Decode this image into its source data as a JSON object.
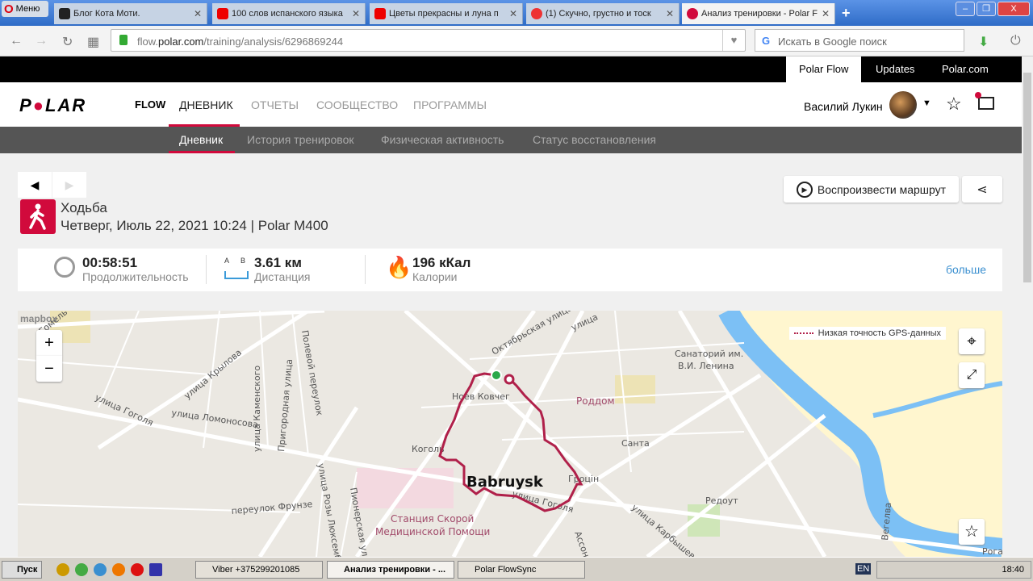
{
  "browser": {
    "menu_label": "Меню",
    "tabs": [
      {
        "title": "Блог Кота Моти.",
        "color": "#222"
      },
      {
        "title": "100 слов испанского языка",
        "color": "#e00"
      },
      {
        "title": "Цветы прекрасны и луна п",
        "color": "#e00"
      },
      {
        "title": "(1) Скучно, грустно и тоск",
        "color": "#e33"
      },
      {
        "title": "Анализ тренировки - Polar F",
        "color": "#d10a3c"
      }
    ],
    "url_prefix": "flow.",
    "url_domain": "polar.com",
    "url_path": "/training/analysis/6296869244",
    "search_placeholder": "Искать в Google поиск"
  },
  "polar_top": {
    "items": [
      "Polar Flow",
      "Updates",
      "Polar.com"
    ]
  },
  "header": {
    "logo": "POLAR",
    "flow": "FLOW",
    "nav": [
      "ДНЕВНИК",
      "ОТЧЕТЫ",
      "СООБЩЕСТВО",
      "ПРОГРАММЫ"
    ],
    "user": "Василий Лукин"
  },
  "subnav": [
    "Дневник",
    "История тренировок",
    "Физическая активность",
    "Статус восстановления"
  ],
  "workout": {
    "sport": "Ходьба",
    "date_device": "Четверг, Июль 22, 2021 10:24 | Polar M400",
    "replay": "Воспроизвести маршрут",
    "stats": [
      {
        "value": "00:58:51",
        "label": "Продолжительность"
      },
      {
        "value": "3.61 км",
        "label": "Дистанция",
        "icon_text": "A B"
      },
      {
        "value": "196 кКал",
        "label": "Калории"
      }
    ],
    "more": "больше"
  },
  "map": {
    "attribution": "mapbox",
    "legend": "Низкая точность GPS-данных",
    "city": "Babruysk",
    "streets": [
      "улица Крылова",
      "улица Каменского",
      "Пригородная улица",
      "Полевой переулок",
      "улица Гоголя",
      "улица Ломоносова",
      "переулок Фрунзе",
      "улица Розы Люксембург",
      "Пионерская улица",
      "Октябрьская улица",
      "улица Гоголя",
      "улица Карбышева",
      "Гомель",
      "улица",
      "Вегелва",
      "Рогачёв",
      "Ассонова"
    ],
    "pois": [
      "Ноев Ковчег",
      "Коголь",
      "Роддом",
      "Санта",
      "Гроцін",
      "Редоут",
      "Станция Скорой",
      "Медицинской Помощи",
      "Санаторий им.",
      "В.И. Ленина"
    ],
    "route_color": "#b0204a"
  },
  "taskbar": {
    "start": "Пуск",
    "items": [
      "Viber +375299201085",
      "Анализ тренировки - ...",
      "Polar FlowSync"
    ],
    "lang": "EN",
    "time": "18:40"
  }
}
